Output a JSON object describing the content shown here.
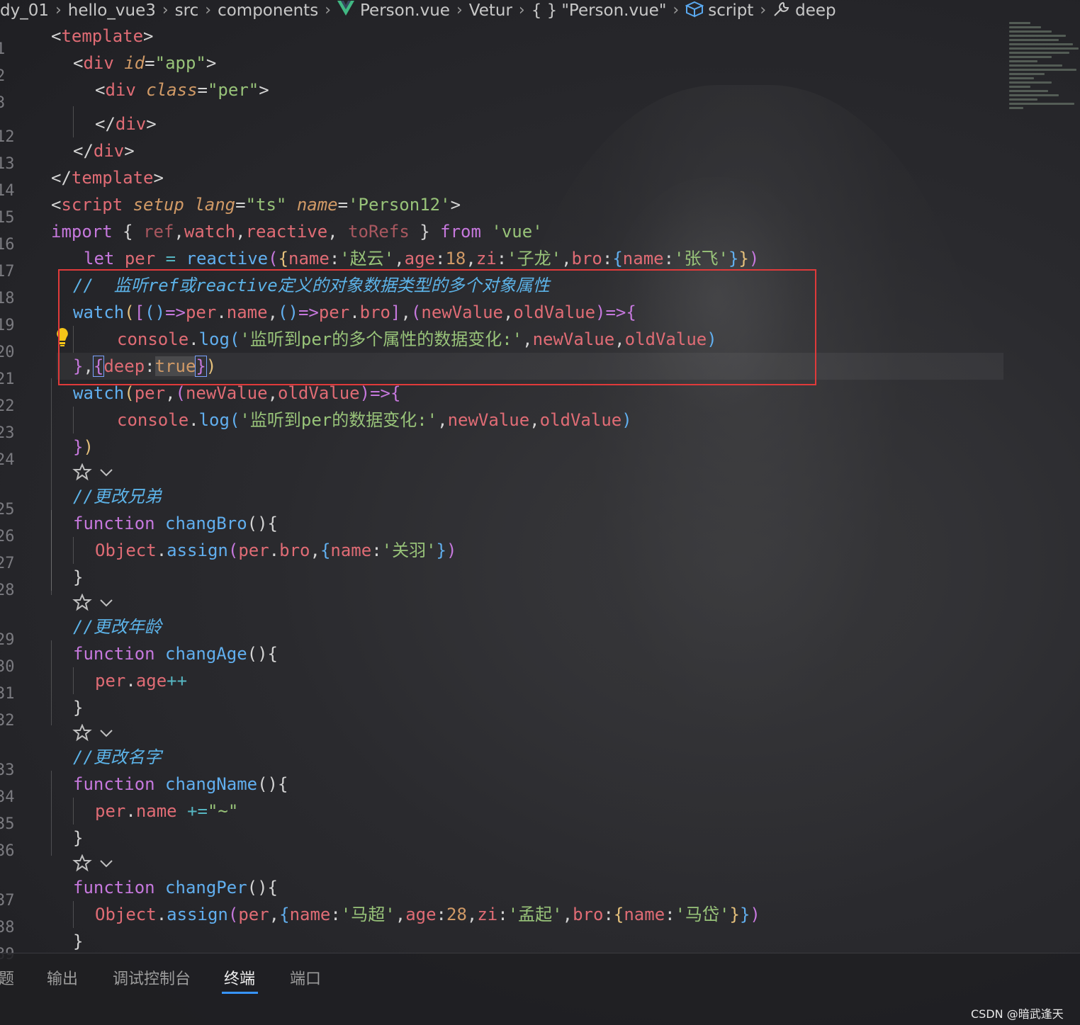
{
  "breadcrumb": {
    "items": [
      "dy_01",
      "hello_vue3",
      "src",
      "components",
      "Person.vue",
      "Vetur",
      "\"Person.vue\"",
      "script",
      "deep"
    ]
  },
  "line_numbers": [
    "1",
    "2",
    "3",
    "12",
    "13",
    "14",
    "15",
    "16",
    "17",
    "18",
    "19",
    "20",
    "21",
    "22",
    "23",
    "24",
    "25",
    "26",
    "27",
    "28",
    "29",
    "30",
    "31",
    "32",
    "33",
    "34",
    "35",
    "36",
    "37",
    "38",
    "39"
  ],
  "code": {
    "template_open": "template",
    "div_app_attr": "id",
    "div_app_value": "\"app\"",
    "div_per_attr": "class",
    "div_per_value": "\"per\"",
    "div_close": "div",
    "template_close": "template",
    "script_tag": "script",
    "script_setup": "setup",
    "script_lang": "lang",
    "script_lang_value": "\"ts\"",
    "script_name": "name",
    "script_name_value": "'Person12'",
    "import_kw": "import",
    "import_ref": "ref",
    "import_watch": "watch",
    "import_reactive": "reactive",
    "import_torefs": "toRefs",
    "from_kw": "from",
    "import_source": "'vue'",
    "let_kw": "let",
    "per_var": "per",
    "reactive_fn": "reactive",
    "name_key": "name",
    "name_val": "'赵云'",
    "age_key": "age",
    "age_val": "18",
    "zi_key": "zi",
    "zi_val": "'子龙'",
    "bro_key": "bro",
    "bro_name_val": "'张飞'",
    "comment_multi": "//  监听ref或reactive定义的对象数据类型的多个对象属性",
    "watch_fn": "watch",
    "new_value": "newValue",
    "old_value": "oldValue",
    "console_obj": "console",
    "log_fn": "log",
    "log_multi_str": "'监听到per的多个属性的数据变化:'",
    "deep_key": "deep",
    "true_val": "true",
    "log_per_str": "'监听到per的数据变化:'",
    "comment_bro": "//更改兄弟",
    "function_kw": "function",
    "chang_bro": "changBro",
    "object_obj": "Object",
    "assign_fn": "assign",
    "guanyu_val": "'关羽'",
    "comment_age": "//更改年龄",
    "chang_age": "changAge",
    "age_prop": "age",
    "comment_name": "//更改名字",
    "chang_name": "changName",
    "name_prop": "name",
    "tilde_val": "\"~\"",
    "chang_per": "changPer",
    "machao_val": "'马超'",
    "age28_val": "28",
    "mengqi_val": "'孟起'",
    "madai_val": "'马岱'"
  },
  "panel": {
    "tabs": [
      "题",
      "输出",
      "调试控制台",
      "终端",
      "端口"
    ],
    "active_tab": "终端"
  },
  "watermark": "CSDN @暗武逢天",
  "colors": {
    "accent": "#3794ff",
    "highlight_box": "#e03a3a",
    "vue_green": "#41b883"
  }
}
